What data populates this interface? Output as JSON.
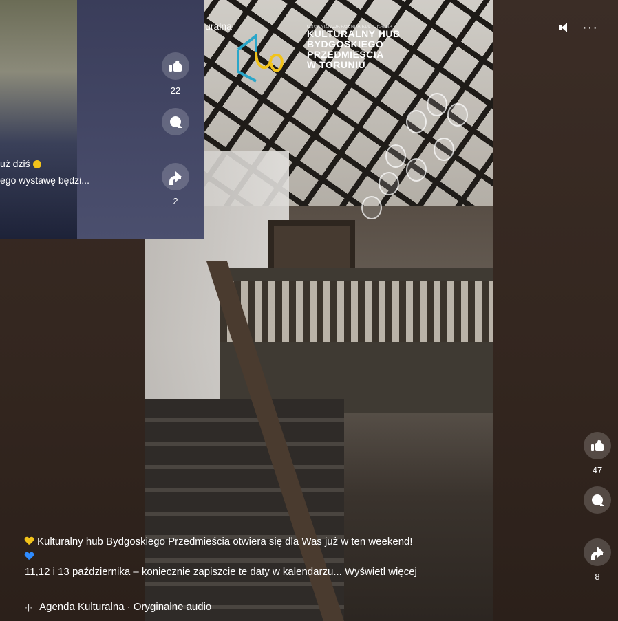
{
  "card": {
    "caption_line1": "uż dziś",
    "caption_line2": "ego wystawę będzi...",
    "header_fragment": "uralna",
    "like_count": "22",
    "share_count": "2"
  },
  "video": {
    "sign_small": "ORGANIZACJA AGENDA KULTURALNA",
    "sign_line1": "KULTURALNY HUB",
    "sign_line2": "BYDGOSKIEGO",
    "sign_line3": "PRZEDMIEŚCIA",
    "sign_line4": "W TORUNIU"
  },
  "caption": {
    "line1": "Kulturalny hub Bydgoskiego Przedmieścia otwiera się dla Was już w ten weekend!",
    "line3": "11,12 i 13 października – koniecznie zapiszcie te daty w kalendarzu...",
    "see_more": "Wyświetl więcej",
    "source": "Agenda Kulturalna · Oryginalne audio"
  },
  "actions": {
    "like_count": "47",
    "share_count": "8"
  },
  "icons": [
    "like-icon",
    "comment-icon",
    "share-icon",
    "volume-muted-icon",
    "more-options-icon",
    "audio-wave-icon",
    "yellow-heart-icon",
    "blue-heart-icon",
    "sun-emoji-icon"
  ],
  "colors": {
    "background": "#3a2a22",
    "yellow_heart": "#f2c31a",
    "blue_heart": "#2f8cff"
  }
}
